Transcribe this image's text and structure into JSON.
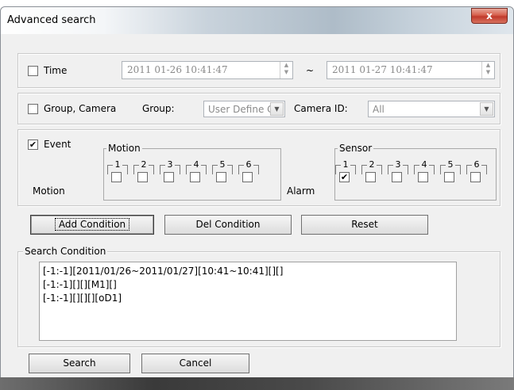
{
  "window": {
    "title": "Advanced search",
    "close_glyph": "x"
  },
  "time": {
    "label": "Time",
    "checked": false,
    "from": "2011 01-26 10:41:47",
    "separator": "~",
    "to": "2011 01-27 10:41:47"
  },
  "group_camera": {
    "label": "Group, Camera",
    "checked": false,
    "group_label": "Group:",
    "group_value": "User Define C",
    "camera_label": "Camera ID:",
    "camera_value": "All"
  },
  "event": {
    "label": "Event",
    "checked": true,
    "motion_group_title": "Motion",
    "motion_row_label": "Motion",
    "motion_channels": [
      {
        "num": "1",
        "checked": false
      },
      {
        "num": "2",
        "checked": false
      },
      {
        "num": "3",
        "checked": false
      },
      {
        "num": "4",
        "checked": false
      },
      {
        "num": "5",
        "checked": false
      },
      {
        "num": "6",
        "checked": false
      }
    ],
    "alarm_label": "Alarm",
    "sensor_group_title": "Sensor",
    "sensor_channels": [
      {
        "num": "1",
        "checked": true
      },
      {
        "num": "2",
        "checked": false
      },
      {
        "num": "3",
        "checked": false
      },
      {
        "num": "4",
        "checked": false
      },
      {
        "num": "5",
        "checked": false
      },
      {
        "num": "6",
        "checked": false
      }
    ]
  },
  "actions": {
    "add": "Add Condition",
    "del": "Del Condition",
    "reset": "Reset"
  },
  "search_condition": {
    "title": "Search Condition",
    "lines": [
      "[-1:-1][2011/01/26~2011/01/27][10:41~10:41][][]",
      "[-1:-1][][][M1][]",
      "[-1:-1][][][][oD1]"
    ]
  },
  "footer": {
    "search": "Search",
    "cancel": "Cancel"
  },
  "check_glyph": "✔"
}
